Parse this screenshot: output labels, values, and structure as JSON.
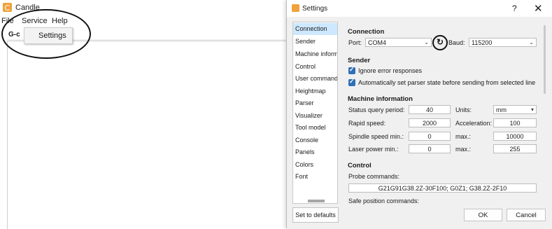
{
  "main": {
    "title": "Candle",
    "menu": [
      "File",
      "Service",
      "Help"
    ],
    "tab_label": "G-c",
    "dropdown_item": "Settings"
  },
  "dialog": {
    "title": "Settings",
    "help_glyph": "?",
    "close_glyph": "✕",
    "nav": [
      "Connection",
      "Sender",
      "Machine information",
      "Control",
      "User commands",
      "Heightmap",
      "Parser",
      "Visualizer",
      "Tool model",
      "Console",
      "Panels",
      "Colors",
      "Font"
    ],
    "set_defaults": "Set to defaults",
    "ok": "OK",
    "cancel": "Cancel",
    "connection": {
      "heading": "Connection",
      "port_label": "Port:",
      "port_value": "COM4",
      "baud_label": "Baud:",
      "baud_value": "115200"
    },
    "sender": {
      "heading": "Sender",
      "ignore_errors": "Ignore error responses",
      "auto_parser": "Automatically set parser state before sending from selected line"
    },
    "machine": {
      "heading": "Machine information",
      "status_query_label": "Status query period:",
      "status_query_value": "40",
      "units_label": "Units:",
      "units_value": "mm",
      "rapid_label": "Rapid speed:",
      "rapid_value": "2000",
      "accel_label": "Acceleration:",
      "accel_value": "100",
      "spindle_min_label": "Spindle speed min.:",
      "spindle_min_value": "0",
      "spindle_max_label": "max.:",
      "spindle_max_value": "10000",
      "laser_min_label": "Laser power min.:",
      "laser_min_value": "0",
      "laser_max_label": "max.:",
      "laser_max_value": "255"
    },
    "control": {
      "heading": "Control",
      "probe_label": "Probe commands:",
      "probe_value": "G21G91G38.2Z-30F100; G0Z1; G38.2Z-2F10",
      "safe_label": "Safe position commands:"
    }
  }
}
